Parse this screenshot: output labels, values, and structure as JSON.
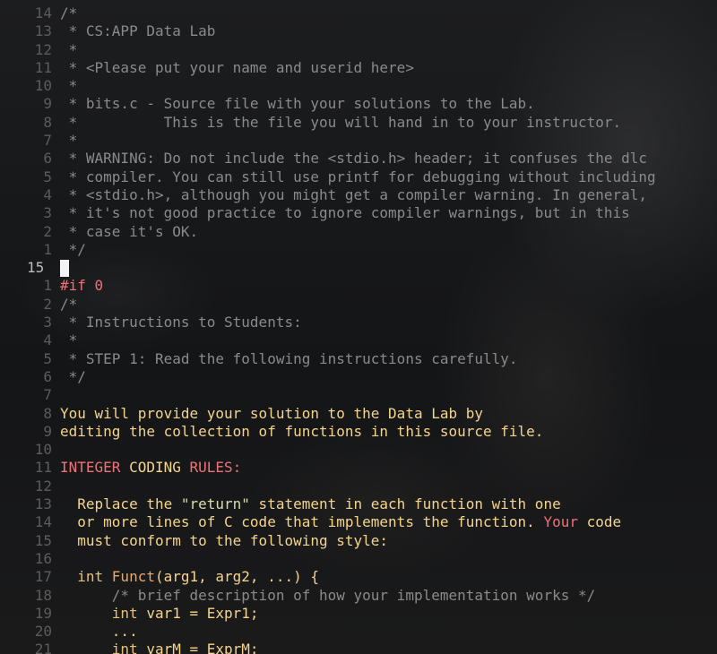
{
  "editor": {
    "current_line": "15",
    "lines": [
      {
        "ln": "14",
        "segments": [
          {
            "t": "/*",
            "c": "cm"
          }
        ]
      },
      {
        "ln": "13",
        "segments": [
          {
            "t": " * CS:APP Data Lab",
            "c": "cm"
          }
        ]
      },
      {
        "ln": "12",
        "segments": [
          {
            "t": " *",
            "c": "cm"
          }
        ]
      },
      {
        "ln": "11",
        "segments": [
          {
            "t": " * <Please put your name and userid here>",
            "c": "cm"
          }
        ]
      },
      {
        "ln": "10",
        "segments": [
          {
            "t": " *",
            "c": "cm"
          }
        ]
      },
      {
        "ln": "9",
        "segments": [
          {
            "t": " * bits.c - Source file with your solutions to the Lab.",
            "c": "cm"
          }
        ]
      },
      {
        "ln": "8",
        "segments": [
          {
            "t": " *          This is the file you will hand in to your instructor.",
            "c": "cm"
          }
        ]
      },
      {
        "ln": "7",
        "segments": [
          {
            "t": " *",
            "c": "cm"
          }
        ]
      },
      {
        "ln": "6",
        "segments": [
          {
            "t": " * WARNING: Do not include the <stdio.h> header; it confuses the dlc",
            "c": "cm"
          }
        ]
      },
      {
        "ln": "5",
        "segments": [
          {
            "t": " * compiler. You can still use printf for debugging without including",
            "c": "cm"
          }
        ]
      },
      {
        "ln": "4",
        "segments": [
          {
            "t": " * <stdio.h>, although you might get a compiler warning. In general,",
            "c": "cm"
          }
        ]
      },
      {
        "ln": "3",
        "segments": [
          {
            "t": " * it's not good practice to ignore compiler warnings, but in this",
            "c": "cm"
          }
        ]
      },
      {
        "ln": "2",
        "segments": [
          {
            "t": " * case it's OK.",
            "c": "cm"
          }
        ]
      },
      {
        "ln": "1",
        "segments": [
          {
            "t": " */",
            "c": "cm"
          }
        ]
      },
      {
        "ln": "15",
        "current": true,
        "segments": []
      },
      {
        "ln": "1",
        "segments": [
          {
            "t": "#if 0",
            "c": "pp"
          }
        ]
      },
      {
        "ln": "2",
        "segments": [
          {
            "t": "/*",
            "c": "cm"
          }
        ]
      },
      {
        "ln": "3",
        "segments": [
          {
            "t": " * Instructions to Students:",
            "c": "cm"
          }
        ]
      },
      {
        "ln": "4",
        "segments": [
          {
            "t": " *",
            "c": "cm"
          }
        ]
      },
      {
        "ln": "5",
        "segments": [
          {
            "t": " * STEP 1: Read the following instructions carefully.",
            "c": "cm"
          }
        ]
      },
      {
        "ln": "6",
        "segments": [
          {
            "t": " */",
            "c": "cm"
          }
        ]
      },
      {
        "ln": "7",
        "segments": []
      },
      {
        "ln": "8",
        "segments": [
          {
            "t": "You will provide your solution to the Data Lab by",
            "c": "tx"
          }
        ]
      },
      {
        "ln": "9",
        "segments": [
          {
            "t": "editing the collection of functions in this source file.",
            "c": "tx"
          }
        ]
      },
      {
        "ln": "10",
        "segments": []
      },
      {
        "ln": "11",
        "segments": [
          {
            "t": "INTEGER ",
            "c": "rd"
          },
          {
            "t": "CODING ",
            "c": "tx"
          },
          {
            "t": "RULES:",
            "c": "rd"
          }
        ]
      },
      {
        "ln": "12",
        "segments": []
      },
      {
        "ln": "13",
        "segments": [
          {
            "t": "  Replace the ",
            "c": "tx"
          },
          {
            "t": "\"return\"",
            "c": "st"
          },
          {
            "t": " statement in each function with one",
            "c": "tx"
          }
        ]
      },
      {
        "ln": "14",
        "segments": [
          {
            "t": "  or more lines of C code that implements the function. ",
            "c": "tx"
          },
          {
            "t": "Your",
            "c": "rd"
          },
          {
            "t": " code",
            "c": "tx"
          }
        ]
      },
      {
        "ln": "15",
        "segments": [
          {
            "t": "  must conform to the following style:",
            "c": "tx"
          }
        ]
      },
      {
        "ln": "16",
        "segments": []
      },
      {
        "ln": "17",
        "segments": [
          {
            "t": "  int ",
            "c": "ty"
          },
          {
            "t": "Funct",
            "c": "fn"
          },
          {
            "t": "(arg1, arg2, ...) {",
            "c": "tx"
          }
        ]
      },
      {
        "ln": "18",
        "segments": [
          {
            "t": "      /* brief description of how your implementation works */",
            "c": "cm"
          }
        ]
      },
      {
        "ln": "19",
        "segments": [
          {
            "t": "      int ",
            "c": "ty"
          },
          {
            "t": "var1 = Expr1;",
            "c": "tx"
          }
        ]
      },
      {
        "ln": "20",
        "segments": [
          {
            "t": "      ...",
            "c": "tx"
          }
        ]
      },
      {
        "ln": "21",
        "segments": [
          {
            "t": "      int ",
            "c": "ty"
          },
          {
            "t": "varM = ExprM;",
            "c": "tx"
          }
        ]
      }
    ]
  }
}
